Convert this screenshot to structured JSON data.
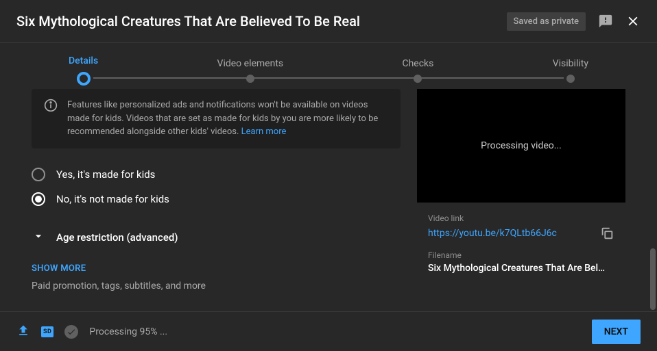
{
  "header": {
    "title": "Six Mythological Creatures That Are Believed To Be Real",
    "saved_badge": "Saved as private"
  },
  "stepper": {
    "steps": [
      {
        "label": "Details",
        "active": true
      },
      {
        "label": "Video elements",
        "active": false
      },
      {
        "label": "Checks",
        "active": false
      },
      {
        "label": "Visibility",
        "active": false
      }
    ]
  },
  "info": {
    "text_prefix": "Features like personalized ads and notifications won't be available on videos made for kids. Videos that are set as made for kids by you are more likely to be recommended alongside other kids' videos. ",
    "learn_more": "Learn more"
  },
  "radios": {
    "yes": "Yes, it's made for kids",
    "no": "No, it's not made for kids"
  },
  "expand": {
    "label": "Age restriction (advanced)"
  },
  "show_more": {
    "label": "SHOW MORE",
    "desc": "Paid promotion, tags, subtitles, and more"
  },
  "preview": {
    "status": "Processing video..."
  },
  "meta": {
    "link_label": "Video link",
    "link": "https://youtu.be/k7QLtb66J6c",
    "filename_label": "Filename",
    "filename": "Six Mythological Creatures That Are Bel…"
  },
  "footer": {
    "hd": "SD",
    "processing": "Processing 95% ...",
    "next": "NEXT"
  }
}
